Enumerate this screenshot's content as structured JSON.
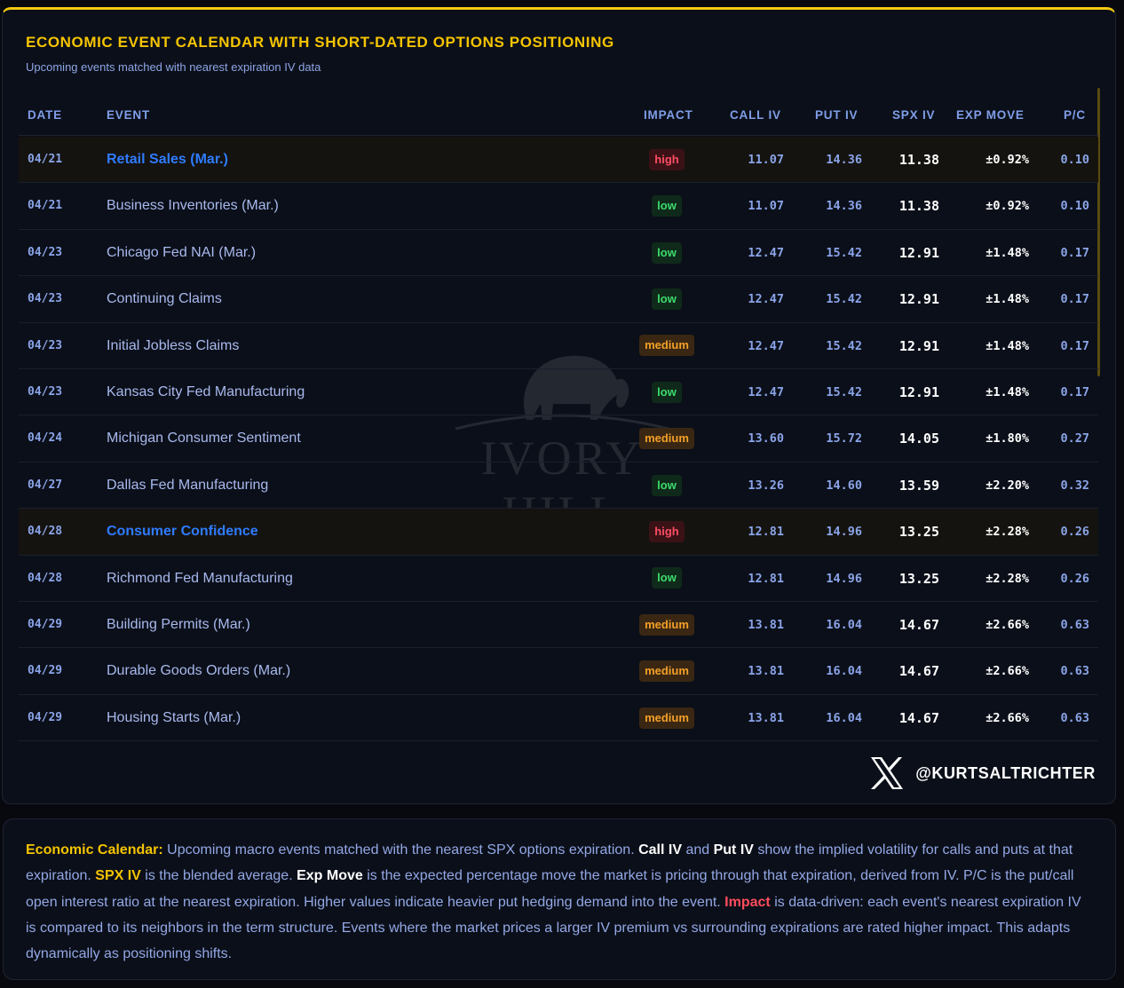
{
  "header": {
    "title": "ECONOMIC EVENT CALENDAR WITH SHORT-DATED OPTIONS POSITIONING",
    "subtitle": "Upcoming events matched with nearest expiration IV data"
  },
  "columns": {
    "date": "DATE",
    "event": "EVENT",
    "impact": "IMPACT",
    "call_iv": "CALL IV",
    "put_iv": "PUT IV",
    "spx_iv": "SPX IV",
    "exp_move": "EXP MOVE",
    "pc": "P/C"
  },
  "rows": [
    {
      "date": "04/21",
      "event": "Retail Sales (Mar.)",
      "impact": "high",
      "call_iv": "11.07",
      "put_iv": "14.36",
      "spx_iv": "11.38",
      "exp_move": "±0.92%",
      "pc": "0.10"
    },
    {
      "date": "04/21",
      "event": "Business Inventories (Mar.)",
      "impact": "low",
      "call_iv": "11.07",
      "put_iv": "14.36",
      "spx_iv": "11.38",
      "exp_move": "±0.92%",
      "pc": "0.10"
    },
    {
      "date": "04/23",
      "event": "Chicago Fed NAI (Mar.)",
      "impact": "low",
      "call_iv": "12.47",
      "put_iv": "15.42",
      "spx_iv": "12.91",
      "exp_move": "±1.48%",
      "pc": "0.17"
    },
    {
      "date": "04/23",
      "event": "Continuing Claims",
      "impact": "low",
      "call_iv": "12.47",
      "put_iv": "15.42",
      "spx_iv": "12.91",
      "exp_move": "±1.48%",
      "pc": "0.17"
    },
    {
      "date": "04/23",
      "event": "Initial Jobless Claims",
      "impact": "medium",
      "call_iv": "12.47",
      "put_iv": "15.42",
      "spx_iv": "12.91",
      "exp_move": "±1.48%",
      "pc": "0.17"
    },
    {
      "date": "04/23",
      "event": "Kansas City Fed Manufacturing",
      "impact": "low",
      "call_iv": "12.47",
      "put_iv": "15.42",
      "spx_iv": "12.91",
      "exp_move": "±1.48%",
      "pc": "0.17"
    },
    {
      "date": "04/24",
      "event": "Michigan Consumer Sentiment",
      "impact": "medium",
      "call_iv": "13.60",
      "put_iv": "15.72",
      "spx_iv": "14.05",
      "exp_move": "±1.80%",
      "pc": "0.27"
    },
    {
      "date": "04/27",
      "event": "Dallas Fed Manufacturing",
      "impact": "low",
      "call_iv": "13.26",
      "put_iv": "14.60",
      "spx_iv": "13.59",
      "exp_move": "±2.20%",
      "pc": "0.32"
    },
    {
      "date": "04/28",
      "event": "Consumer Confidence",
      "impact": "high",
      "call_iv": "12.81",
      "put_iv": "14.96",
      "spx_iv": "13.25",
      "exp_move": "±2.28%",
      "pc": "0.26"
    },
    {
      "date": "04/28",
      "event": "Richmond Fed Manufacturing",
      "impact": "low",
      "call_iv": "12.81",
      "put_iv": "14.96",
      "spx_iv": "13.25",
      "exp_move": "±2.28%",
      "pc": "0.26"
    },
    {
      "date": "04/29",
      "event": "Building Permits (Mar.)",
      "impact": "medium",
      "call_iv": "13.81",
      "put_iv": "16.04",
      "spx_iv": "14.67",
      "exp_move": "±2.66%",
      "pc": "0.63"
    },
    {
      "date": "04/29",
      "event": "Durable Goods Orders (Mar.)",
      "impact": "medium",
      "call_iv": "13.81",
      "put_iv": "16.04",
      "spx_iv": "14.67",
      "exp_move": "±2.66%",
      "pc": "0.63"
    },
    {
      "date": "04/29",
      "event": "Housing Starts (Mar.)",
      "impact": "medium",
      "call_iv": "13.81",
      "put_iv": "16.04",
      "spx_iv": "14.67",
      "exp_move": "±2.66%",
      "pc": "0.63"
    }
  ],
  "watermark": {
    "text": "IVORY HILL",
    "icon": "elephant-icon"
  },
  "social": {
    "handle": "@KURTSALTRICHTER",
    "icon": "x-logo-icon"
  },
  "note": {
    "label1": "Economic Calendar:",
    "text1": " Upcoming macro events matched with the nearest SPX options expiration. ",
    "label2": "Call IV",
    "text2": " and ",
    "label3": "Put IV",
    "text3": " show the implied volatility for calls and puts at that expiration. ",
    "label4": "SPX IV",
    "text4": " is the blended average. ",
    "label5": "Exp Move",
    "text5": " is the expected percentage move the market is pricing through that expiration, derived from IV. P/C is the put/call open interest ratio at the nearest expiration. Higher values indicate heavier put hedging demand into the event. ",
    "label6": "Impact",
    "text6": " is data-driven: each event's nearest expiration IV is compared to its neighbors in the term structure. Events where the market prices a larger IV premium vs surrounding expirations are rated higher impact. This adapts dynamically as positioning shifts."
  },
  "colors": {
    "accent": "#f5c400",
    "high": "#ff4d63",
    "low": "#3ddc6d",
    "medium": "#f3a028",
    "link": "#2f7bff"
  }
}
